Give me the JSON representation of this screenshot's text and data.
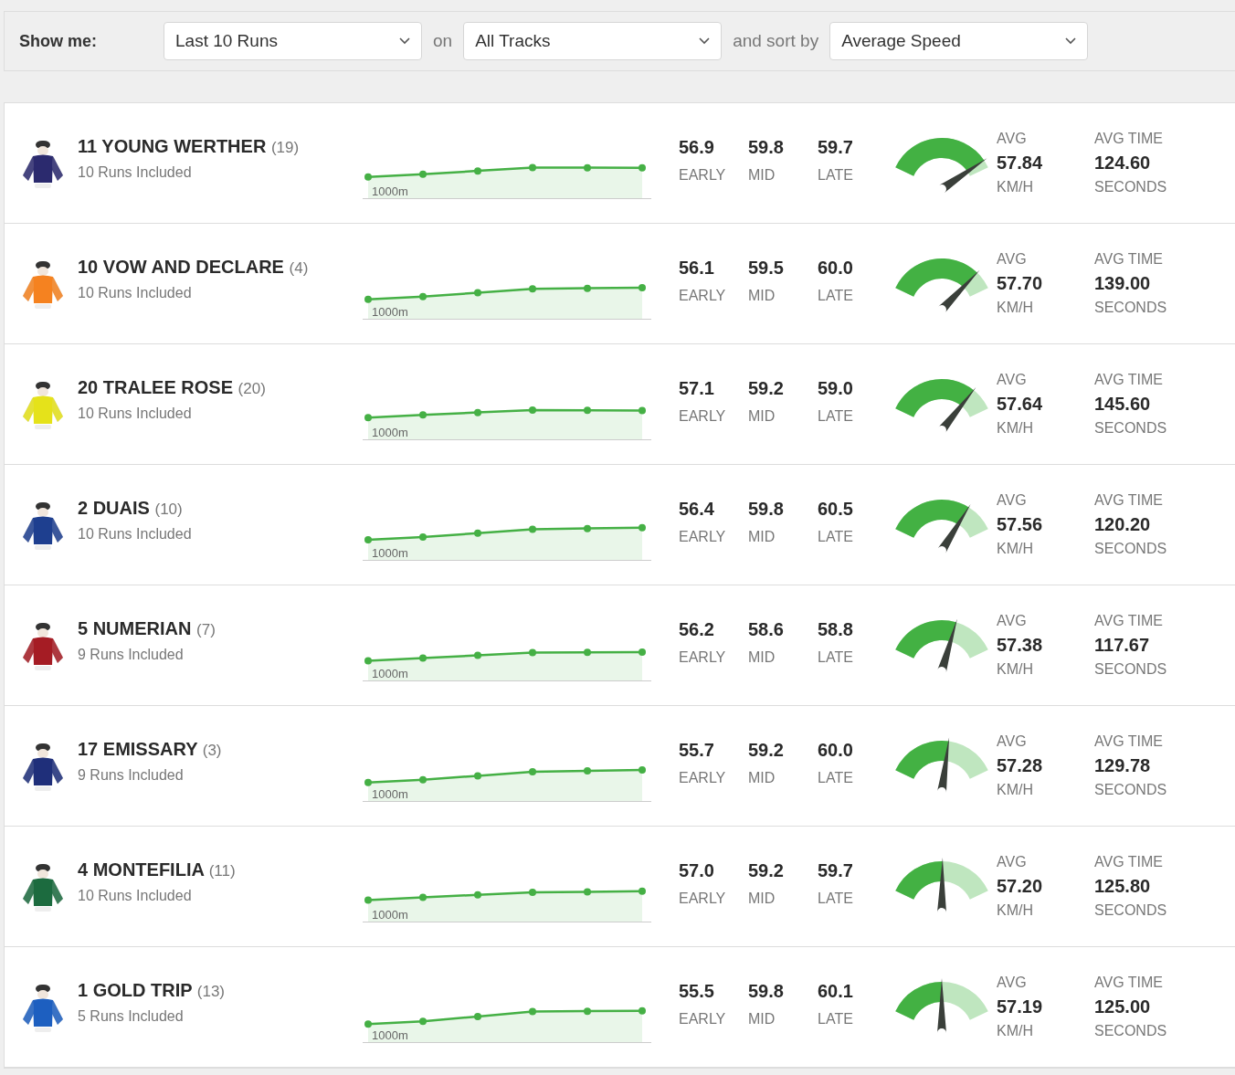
{
  "filter_bar": {
    "label": "Show me:",
    "period": {
      "value": "Last 10 Runs"
    },
    "joiner_1": "on",
    "track": {
      "value": "All Tracks"
    },
    "joiner_2": "and sort by",
    "sort": {
      "value": "Average Speed"
    }
  },
  "runners": [
    {
      "name": "11 YOUNG WERTHER",
      "barrier": "(19)",
      "runs": "10 Runs Included",
      "color": "#2b2a6e",
      "distance_label": "1000m",
      "early": "56.9",
      "early_label": "EARLY",
      "mid": "59.8",
      "mid_label": "MID",
      "late": "59.7",
      "late_label": "LATE",
      "avg_label": "AVG",
      "avg_speed": "57.84",
      "speed_unit": "KM/H",
      "time_label": "AVG TIME",
      "avg_time": "124.60",
      "time_unit": "SECONDS"
    },
    {
      "name": "10 VOW AND DECLARE",
      "barrier": "(4)",
      "runs": "10 Runs Included",
      "color": "#f58220",
      "distance_label": "1000m",
      "early": "56.1",
      "early_label": "EARLY",
      "mid": "59.5",
      "mid_label": "MID",
      "late": "60.0",
      "late_label": "LATE",
      "avg_label": "AVG",
      "avg_speed": "57.70",
      "speed_unit": "KM/H",
      "time_label": "AVG TIME",
      "avg_time": "139.00",
      "time_unit": "SECONDS"
    },
    {
      "name": "20 TRALEE ROSE",
      "barrier": "(20)",
      "runs": "10 Runs Included",
      "color": "#e5e21a",
      "distance_label": "1000m",
      "early": "57.1",
      "early_label": "EARLY",
      "mid": "59.2",
      "mid_label": "MID",
      "late": "59.0",
      "late_label": "LATE",
      "avg_label": "AVG",
      "avg_speed": "57.64",
      "speed_unit": "KM/H",
      "time_label": "AVG TIME",
      "avg_time": "145.60",
      "time_unit": "SECONDS"
    },
    {
      "name": "2 DUAIS",
      "barrier": "(10)",
      "runs": "10 Runs Included",
      "color": "#1e3f8f",
      "distance_label": "1000m",
      "early": "56.4",
      "early_label": "EARLY",
      "mid": "59.8",
      "mid_label": "MID",
      "late": "60.5",
      "late_label": "LATE",
      "avg_label": "AVG",
      "avg_speed": "57.56",
      "speed_unit": "KM/H",
      "time_label": "AVG TIME",
      "avg_time": "120.20",
      "time_unit": "SECONDS"
    },
    {
      "name": "5 NUMERIAN",
      "barrier": "(7)",
      "runs": "9 Runs Included",
      "color": "#a51c24",
      "distance_label": "1000m",
      "early": "56.2",
      "early_label": "EARLY",
      "mid": "58.6",
      "mid_label": "MID",
      "late": "58.8",
      "late_label": "LATE",
      "avg_label": "AVG",
      "avg_speed": "57.38",
      "speed_unit": "KM/H",
      "time_label": "AVG TIME",
      "avg_time": "117.67",
      "time_unit": "SECONDS"
    },
    {
      "name": "17 EMISSARY",
      "barrier": "(3)",
      "runs": "9 Runs Included",
      "color": "#1f2f7a",
      "distance_label": "1000m",
      "early": "55.7",
      "early_label": "EARLY",
      "mid": "59.2",
      "mid_label": "MID",
      "late": "60.0",
      "late_label": "LATE",
      "avg_label": "AVG",
      "avg_speed": "57.28",
      "speed_unit": "KM/H",
      "time_label": "AVG TIME",
      "avg_time": "129.78",
      "time_unit": "SECONDS"
    },
    {
      "name": "4 MONTEFILIA",
      "barrier": "(11)",
      "runs": "10 Runs Included",
      "color": "#1c6b3f",
      "distance_label": "1000m",
      "early": "57.0",
      "early_label": "EARLY",
      "mid": "59.2",
      "mid_label": "MID",
      "late": "59.7",
      "late_label": "LATE",
      "avg_label": "AVG",
      "avg_speed": "57.20",
      "speed_unit": "KM/H",
      "time_label": "AVG TIME",
      "avg_time": "125.80",
      "time_unit": "SECONDS"
    },
    {
      "name": "1 GOLD TRIP",
      "barrier": "(13)",
      "runs": "5 Runs Included",
      "color": "#1d5fc0",
      "distance_label": "1000m",
      "early": "55.5",
      "early_label": "EARLY",
      "mid": "59.8",
      "mid_label": "MID",
      "late": "60.1",
      "late_label": "LATE",
      "avg_label": "AVG",
      "avg_speed": "57.19",
      "speed_unit": "KM/H",
      "time_label": "AVG TIME",
      "avg_time": "125.00",
      "time_unit": "SECONDS"
    }
  ]
}
